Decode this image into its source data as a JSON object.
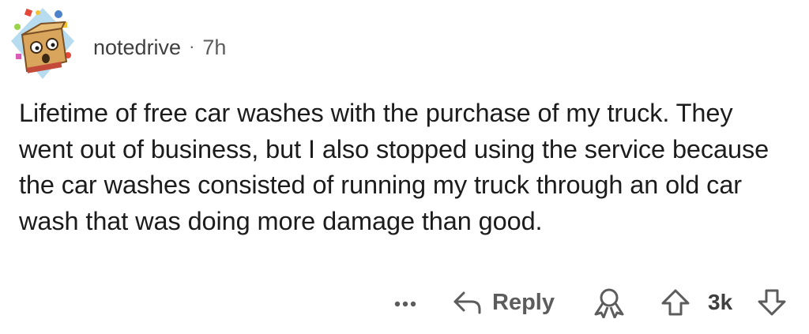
{
  "comment": {
    "author": "notedrive",
    "separator": "·",
    "age": "7h",
    "body": "Lifetime of free car washes with the purchase of my truck. They went out of business, but I also stopped using the service because the car washes consisted of running my truck through an old car wash that was doing more damage than good.",
    "avatar_icon": "snoo-box-avatar-icon"
  },
  "actions": {
    "more_icon": "ellipsis-icon",
    "reply_icon": "reply-arrow-icon",
    "reply_label": "Reply",
    "award_icon": "award-icon",
    "upvote_icon": "upvote-arrow-icon",
    "score": "3k",
    "downvote_icon": "downvote-arrow-icon"
  },
  "colors": {
    "text_primary": "#1c1c1c",
    "text_meta": "#5c5c5c",
    "background": "#ffffff"
  }
}
